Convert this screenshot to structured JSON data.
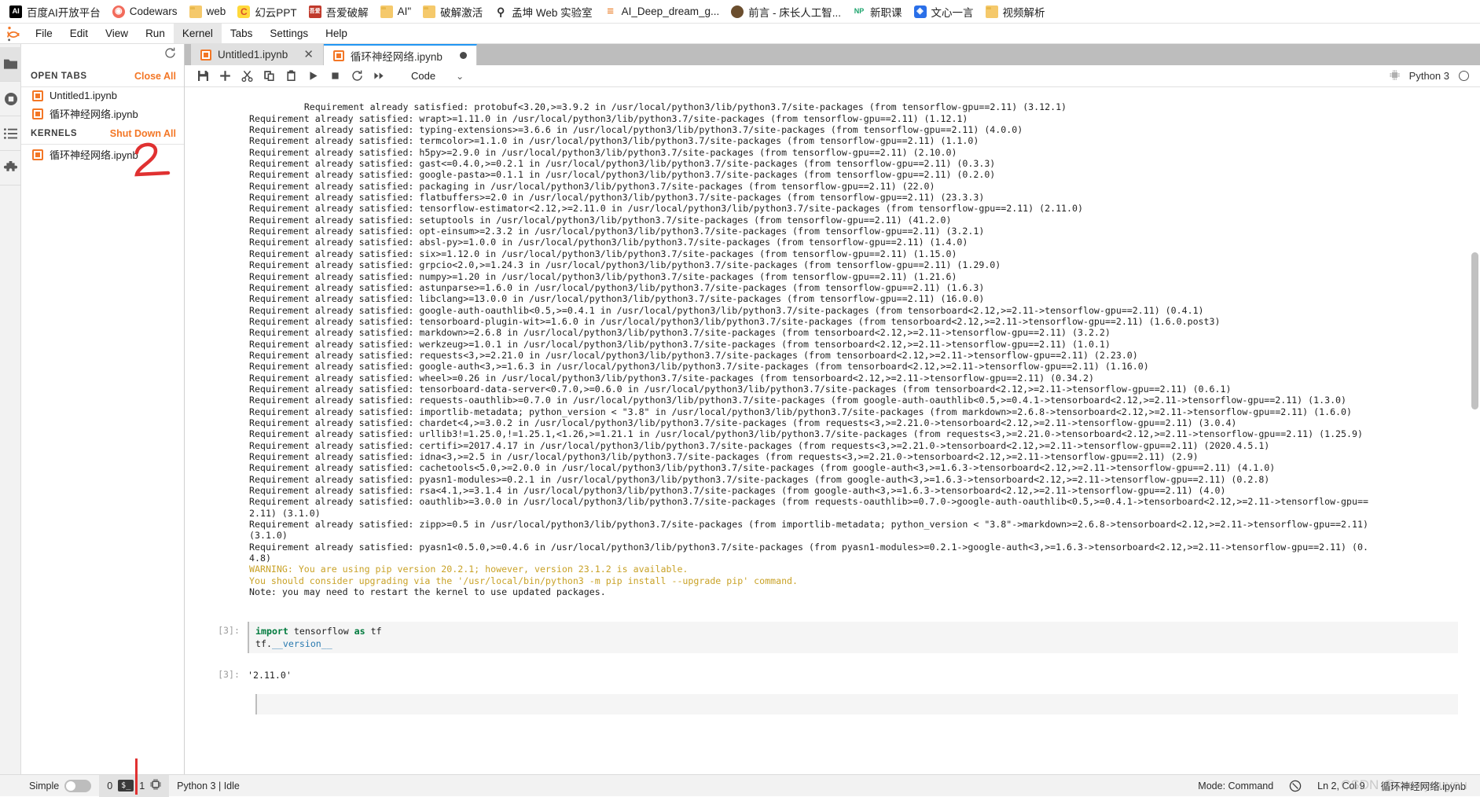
{
  "browser": {
    "bookmarks": [
      {
        "label": "百度AI开放平台",
        "icon": "ai-logo-icon",
        "icon_class": "ico-ai",
        "glyph": "AI"
      },
      {
        "label": "Codewars",
        "icon": "codewars-icon",
        "icon_class": "ico-cw",
        "glyph": "◉"
      },
      {
        "label": "web",
        "icon": "folder-icon",
        "icon_class": "ico-folder",
        "glyph": ""
      },
      {
        "label": "幻云PPT",
        "icon": "huanyun-ppt-icon",
        "icon_class": "ico-hy",
        "glyph": "C"
      },
      {
        "label": "吾爱破解",
        "icon": "wuaipojie-icon",
        "icon_class": "ico-wy",
        "glyph": "吾爱"
      },
      {
        "label": "AI\"",
        "icon": "folder-icon",
        "icon_class": "ico-folder",
        "glyph": ""
      },
      {
        "label": "破解激活",
        "icon": "folder-icon",
        "icon_class": "ico-folder",
        "glyph": ""
      },
      {
        "label": "孟坤 Web 实验室",
        "icon": "wrench-icon",
        "icon_class": "ico-mk",
        "glyph": "⚲"
      },
      {
        "label": "AI_Deep_dream_g...",
        "icon": "menu-lines-icon",
        "icon_class": "ico-dd",
        "glyph": "≡"
      },
      {
        "label": "前言 - 床长人工智...",
        "icon": "globe-icon",
        "icon_class": "ico-qy",
        "glyph": ""
      },
      {
        "label": "新职课",
        "icon": "newprofession-icon",
        "icon_class": "ico-np",
        "glyph": "NP"
      },
      {
        "label": "文心一言",
        "icon": "wenxin-icon",
        "icon_class": "ico-wx",
        "glyph": "◈"
      },
      {
        "label": "视频解析",
        "icon": "folder-icon",
        "icon_class": "ico-folder",
        "glyph": ""
      }
    ]
  },
  "menubar": {
    "items": [
      {
        "label": "File",
        "active": false
      },
      {
        "label": "Edit",
        "active": false
      },
      {
        "label": "View",
        "active": false
      },
      {
        "label": "Run",
        "active": false
      },
      {
        "label": "Kernel",
        "active": true
      },
      {
        "label": "Tabs",
        "active": false
      },
      {
        "label": "Settings",
        "active": false
      },
      {
        "label": "Help",
        "active": false
      }
    ]
  },
  "sidebar": {
    "rail": [
      {
        "name": "file-browser-icon",
        "glyph": "folder",
        "active": true
      },
      {
        "name": "running-terminals-icon",
        "glyph": "stop",
        "active": false
      },
      {
        "name": "table-of-contents-icon",
        "glyph": "list",
        "active": false
      },
      {
        "name": "extension-manager-icon",
        "glyph": "puzzle",
        "active": false
      }
    ],
    "refresh_title": "Refresh",
    "sections": [
      {
        "title": "OPEN TABS",
        "action": "Close All",
        "items": [
          {
            "label": "Untitled1.ipynb"
          },
          {
            "label": "循环神经网络.ipynb"
          }
        ]
      },
      {
        "title": "KERNELS",
        "action": "Shut Down All",
        "items": [
          {
            "label": "循环神经网络.ipynb"
          }
        ]
      }
    ]
  },
  "dock": {
    "tabs": [
      {
        "label": "Untitled1.ipynb",
        "current": false,
        "close": "✕",
        "dirty": false
      },
      {
        "label": "循环神经网络.ipynb",
        "current": true,
        "close": "",
        "dirty": true
      }
    ]
  },
  "notebook_toolbar": {
    "buttons": [
      {
        "name": "save-button",
        "title": "Save"
      },
      {
        "name": "insert-cell-button",
        "title": "Insert cell below"
      },
      {
        "name": "cut-button",
        "title": "Cut"
      },
      {
        "name": "copy-button",
        "title": "Copy"
      },
      {
        "name": "paste-button",
        "title": "Paste"
      },
      {
        "name": "run-button",
        "title": "Run"
      },
      {
        "name": "stop-button",
        "title": "Interrupt kernel"
      },
      {
        "name": "restart-button",
        "title": "Restart kernel"
      },
      {
        "name": "restart-run-all-button",
        "title": "Restart and run all"
      }
    ],
    "celltype_value": "Code",
    "celltype_caret": "⌄",
    "kernel_name": "Python 3"
  },
  "output": {
    "lines": [
      "Requirement already satisfied: protobuf<3.20,>=3.9.2 in /usr/local/python3/lib/python3.7/site-packages (from tensorflow-gpu==2.11) (3.12.1)",
      "Requirement already satisfied: wrapt>=1.11.0 in /usr/local/python3/lib/python3.7/site-packages (from tensorflow-gpu==2.11) (1.12.1)",
      "Requirement already satisfied: typing-extensions>=3.6.6 in /usr/local/python3/lib/python3.7/site-packages (from tensorflow-gpu==2.11) (4.0.0)",
      "Requirement already satisfied: termcolor>=1.1.0 in /usr/local/python3/lib/python3.7/site-packages (from tensorflow-gpu==2.11) (1.1.0)",
      "Requirement already satisfied: h5py>=2.9.0 in /usr/local/python3/lib/python3.7/site-packages (from tensorflow-gpu==2.11) (2.10.0)",
      "Requirement already satisfied: gast<=0.4.0,>=0.2.1 in /usr/local/python3/lib/python3.7/site-packages (from tensorflow-gpu==2.11) (0.3.3)",
      "Requirement already satisfied: google-pasta>=0.1.1 in /usr/local/python3/lib/python3.7/site-packages (from tensorflow-gpu==2.11) (0.2.0)",
      "Requirement already satisfied: packaging in /usr/local/python3/lib/python3.7/site-packages (from tensorflow-gpu==2.11) (22.0)",
      "Requirement already satisfied: flatbuffers>=2.0 in /usr/local/python3/lib/python3.7/site-packages (from tensorflow-gpu==2.11) (23.3.3)",
      "Requirement already satisfied: tensorflow-estimator<2.12,>=2.11.0 in /usr/local/python3/lib/python3.7/site-packages (from tensorflow-gpu==2.11) (2.11.0)",
      "Requirement already satisfied: setuptools in /usr/local/python3/lib/python3.7/site-packages (from tensorflow-gpu==2.11) (41.2.0)",
      "Requirement already satisfied: opt-einsum>=2.3.2 in /usr/local/python3/lib/python3.7/site-packages (from tensorflow-gpu==2.11) (3.2.1)",
      "Requirement already satisfied: absl-py>=1.0.0 in /usr/local/python3/lib/python3.7/site-packages (from tensorflow-gpu==2.11) (1.4.0)",
      "Requirement already satisfied: six>=1.12.0 in /usr/local/python3/lib/python3.7/site-packages (from tensorflow-gpu==2.11) (1.15.0)",
      "Requirement already satisfied: grpcio<2.0,>=1.24.3 in /usr/local/python3/lib/python3.7/site-packages (from tensorflow-gpu==2.11) (1.29.0)",
      "Requirement already satisfied: numpy>=1.20 in /usr/local/python3/lib/python3.7/site-packages (from tensorflow-gpu==2.11) (1.21.6)",
      "Requirement already satisfied: astunparse>=1.6.0 in /usr/local/python3/lib/python3.7/site-packages (from tensorflow-gpu==2.11) (1.6.3)",
      "Requirement already satisfied: libclang>=13.0.0 in /usr/local/python3/lib/python3.7/site-packages (from tensorflow-gpu==2.11) (16.0.0)",
      "Requirement already satisfied: google-auth-oauthlib<0.5,>=0.4.1 in /usr/local/python3/lib/python3.7/site-packages (from tensorboard<2.12,>=2.11->tensorflow-gpu==2.11) (0.4.1)",
      "Requirement already satisfied: tensorboard-plugin-wit>=1.6.0 in /usr/local/python3/lib/python3.7/site-packages (from tensorboard<2.12,>=2.11->tensorflow-gpu==2.11) (1.6.0.post3)",
      "Requirement already satisfied: markdown>=2.6.8 in /usr/local/python3/lib/python3.7/site-packages (from tensorboard<2.12,>=2.11->tensorflow-gpu==2.11) (3.2.2)",
      "Requirement already satisfied: werkzeug>=1.0.1 in /usr/local/python3/lib/python3.7/site-packages (from tensorboard<2.12,>=2.11->tensorflow-gpu==2.11) (1.0.1)",
      "Requirement already satisfied: requests<3,>=2.21.0 in /usr/local/python3/lib/python3.7/site-packages (from tensorboard<2.12,>=2.11->tensorflow-gpu==2.11) (2.23.0)",
      "Requirement already satisfied: google-auth<3,>=1.6.3 in /usr/local/python3/lib/python3.7/site-packages (from tensorboard<2.12,>=2.11->tensorflow-gpu==2.11) (1.16.0)",
      "Requirement already satisfied: wheel>=0.26 in /usr/local/python3/lib/python3.7/site-packages (from tensorboard<2.12,>=2.11->tensorflow-gpu==2.11) (0.34.2)",
      "Requirement already satisfied: tensorboard-data-server<0.7.0,>=0.6.0 in /usr/local/python3/lib/python3.7/site-packages (from tensorboard<2.12,>=2.11->tensorflow-gpu==2.11) (0.6.1)",
      "Requirement already satisfied: requests-oauthlib>=0.7.0 in /usr/local/python3/lib/python3.7/site-packages (from google-auth-oauthlib<0.5,>=0.4.1->tensorboard<2.12,>=2.11->tensorflow-gpu==2.11) (1.3.0)",
      "Requirement already satisfied: importlib-metadata; python_version < \"3.8\" in /usr/local/python3/lib/python3.7/site-packages (from markdown>=2.6.8->tensorboard<2.12,>=2.11->tensorflow-gpu==2.11) (1.6.0)",
      "Requirement already satisfied: chardet<4,>=3.0.2 in /usr/local/python3/lib/python3.7/site-packages (from requests<3,>=2.21.0->tensorboard<2.12,>=2.11->tensorflow-gpu==2.11) (3.0.4)",
      "Requirement already satisfied: urllib3!=1.25.0,!=1.25.1,<1.26,>=1.21.1 in /usr/local/python3/lib/python3.7/site-packages (from requests<3,>=2.21.0->tensorboard<2.12,>=2.11->tensorflow-gpu==2.11) (1.25.9)",
      "Requirement already satisfied: certifi>=2017.4.17 in /usr/local/python3/lib/python3.7/site-packages (from requests<3,>=2.21.0->tensorboard<2.12,>=2.11->tensorflow-gpu==2.11) (2020.4.5.1)",
      "Requirement already satisfied: idna<3,>=2.5 in /usr/local/python3/lib/python3.7/site-packages (from requests<3,>=2.21.0->tensorboard<2.12,>=2.11->tensorflow-gpu==2.11) (2.9)",
      "Requirement already satisfied: cachetools<5.0,>=2.0.0 in /usr/local/python3/lib/python3.7/site-packages (from google-auth<3,>=1.6.3->tensorboard<2.12,>=2.11->tensorflow-gpu==2.11) (4.1.0)",
      "Requirement already satisfied: pyasn1-modules>=0.2.1 in /usr/local/python3/lib/python3.7/site-packages (from google-auth<3,>=1.6.3->tensorboard<2.12,>=2.11->tensorflow-gpu==2.11) (0.2.8)",
      "Requirement already satisfied: rsa<4.1,>=3.1.4 in /usr/local/python3/lib/python3.7/site-packages (from google-auth<3,>=1.6.3->tensorboard<2.12,>=2.11->tensorflow-gpu==2.11) (4.0)",
      "Requirement already satisfied: oauthlib>=3.0.0 in /usr/local/python3/lib/python3.7/site-packages (from requests-oauthlib>=0.7.0->google-auth-oauthlib<0.5,>=0.4.1->tensorboard<2.12,>=2.11->tensorflow-gpu==",
      "2.11) (3.1.0)",
      "Requirement already satisfied: zipp>=0.5 in /usr/local/python3/lib/python3.7/site-packages (from importlib-metadata; python_version < \"3.8\"->markdown>=2.6.8->tensorboard<2.12,>=2.11->tensorflow-gpu==2.11)",
      "(3.1.0)",
      "Requirement already satisfied: pyasn1<0.5.0,>=0.4.6 in /usr/local/python3/lib/python3.7/site-packages (from pyasn1-modules>=0.2.1->google-auth<3,>=1.6.3->tensorboard<2.12,>=2.11->tensorflow-gpu==2.11) (0.",
      "4.8)"
    ],
    "warning_lines": [
      "WARNING: You are using pip version 20.2.1; however, version 23.1.2 is available.",
      "You should consider upgrading via the '/usr/local/bin/python3 -m pip install --upgrade pip' command."
    ],
    "note_line": "Note: you may need to restart the kernel to use updated packages."
  },
  "cells": [
    {
      "prompt": "[3]:",
      "source_kw1": "import",
      "source_mid": " tensorflow ",
      "source_kw2": "as",
      "source_tail": " tf",
      "source_line2_head": "tf.",
      "source_line2_attr": "__version__"
    }
  ],
  "result": {
    "prompt": "[3]:",
    "value": "'2.11.0'"
  },
  "status_bar": {
    "simple_label": "Simple",
    "simple_on": false,
    "terminals_count": "0",
    "terminal_icon_label": "$_",
    "kernels_count": "1",
    "kernel_status": "Python 3 | Idle",
    "mode": "Mode: Command",
    "cursor": "Ln 2, Col 9",
    "file_name": "循环神经网络.ipynb"
  },
  "annotations": {
    "marker_2": "2",
    "color": "#e03131"
  },
  "watermark": "CSDN @crowyouyou"
}
